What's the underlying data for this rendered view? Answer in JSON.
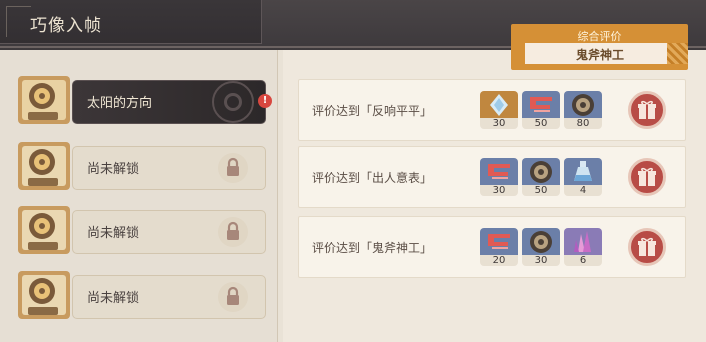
{
  "header": {
    "title": "巧像入帧"
  },
  "rating": {
    "label": "综合评价",
    "value": "鬼斧神工"
  },
  "levels": [
    {
      "name": "太阳的方向",
      "badge": "!"
    },
    {
      "name": "尚未解锁"
    },
    {
      "name": "尚未解锁"
    },
    {
      "name": "尚未解锁"
    }
  ],
  "rewards": [
    {
      "text": "评价达到「反响平平」",
      "items": [
        {
          "icon": "primogem-crystal-icon",
          "count": "30"
        },
        {
          "icon": "red-material-icon",
          "count": "50"
        },
        {
          "icon": "gear-coin-icon",
          "count": "80"
        }
      ]
    },
    {
      "text": "评价达到「出人意表」",
      "items": [
        {
          "icon": "red-material-icon",
          "count": "30"
        },
        {
          "icon": "gear-coin-icon",
          "count": "50"
        },
        {
          "icon": "potion-flask-icon",
          "count": "4"
        }
      ]
    },
    {
      "text": "评价达到「鬼斧神工」",
      "items": [
        {
          "icon": "red-material-icon",
          "count": "20"
        },
        {
          "icon": "gear-coin-icon",
          "count": "30"
        },
        {
          "icon": "purple-crystal-icon",
          "count": "6"
        }
      ]
    }
  ]
}
